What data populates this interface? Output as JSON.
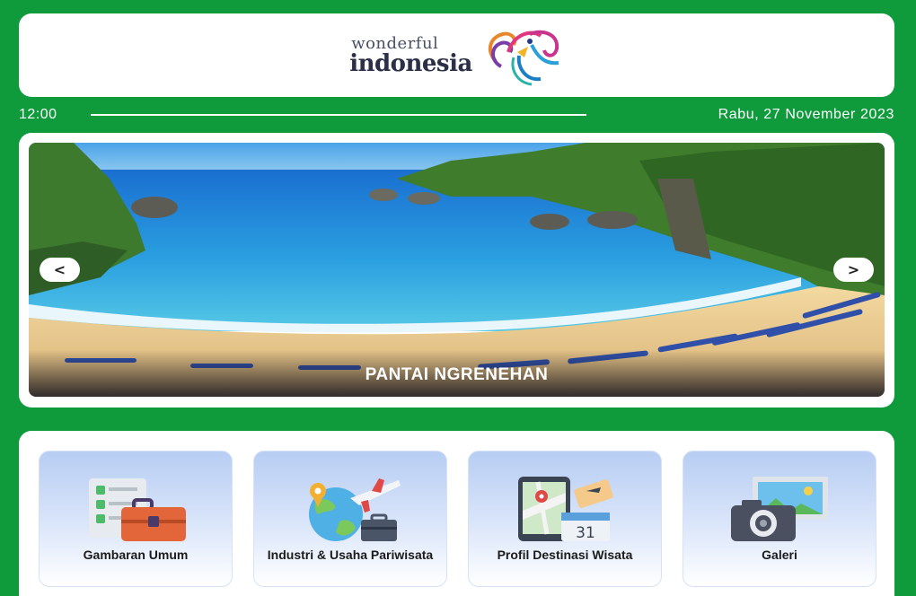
{
  "header": {
    "logo_small": "wonderful",
    "logo_big": "indonesia"
  },
  "timebar": {
    "time": "12:00",
    "date": "Rabu,  27 November 2023"
  },
  "carousel": {
    "prev_icon": "<",
    "next_icon": ">",
    "caption": "PANTAI NGRENEHAN"
  },
  "menu": {
    "items": [
      {
        "label": "Gambaran Umum",
        "icon": "clipboard-briefcase-icon"
      },
      {
        "label": "Industri & Usaha Pariwisata",
        "icon": "globe-airplane-icon"
      },
      {
        "label": "Profil Destinasi Wisata",
        "icon": "phone-map-calendar-icon"
      },
      {
        "label": "Galeri",
        "icon": "camera-picture-icon"
      }
    ],
    "calendar_day": "31"
  },
  "colors": {
    "background": "#0f9a3c",
    "card": "#ffffff",
    "menu_gradient_top": "#b7cdf3"
  }
}
